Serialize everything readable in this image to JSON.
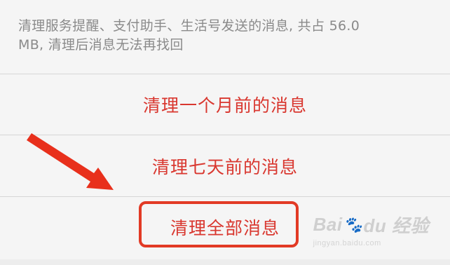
{
  "header": {
    "line1": "清理服务提醒、支付助手、生活号发送的消息, 共占 56.0",
    "line2": "MB, 清理后消息无法再找回"
  },
  "actions": [
    {
      "label": "清理一个月前的消息"
    },
    {
      "label": "清理七天前的消息"
    },
    {
      "label": "清理全部消息"
    }
  ],
  "watermark": {
    "brand_left": "Bai",
    "brand_mark": "🐾",
    "brand_right": "du 经验",
    "url": "jingyan.baidu.com"
  },
  "colors": {
    "action_text": "#d9372f",
    "highlight": "#e23a25",
    "arrow": "#e8301c"
  }
}
